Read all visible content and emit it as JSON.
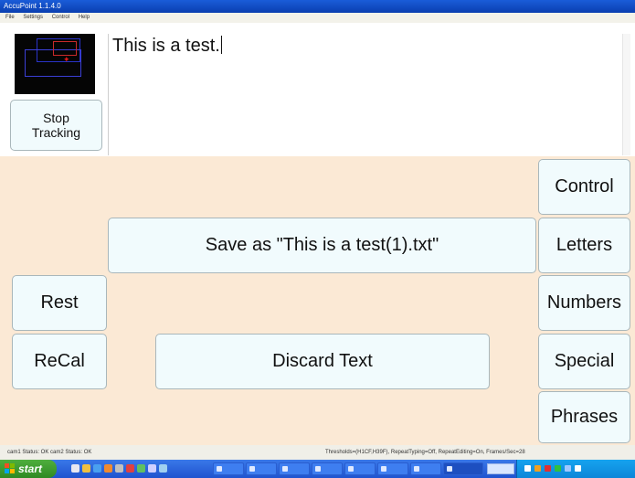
{
  "window": {
    "title": "AccuPoint 1.1.4.0"
  },
  "menu": {
    "items": [
      "File",
      "Settings",
      "Control",
      "Help"
    ]
  },
  "header": {
    "stop_tracking_label": "Stop\nTracking"
  },
  "editor": {
    "text": "This is a test."
  },
  "buttons": {
    "control": "Control",
    "letters": "Letters",
    "numbers": "Numbers",
    "special": "Special",
    "phrases": "Phrases",
    "save": "Save as \"This is a test(1).txt\"",
    "rest": "Rest",
    "recal": "ReCal",
    "discard": "Discard Text"
  },
  "status": {
    "left": "cam1 Status: OK cam2 Status: OK",
    "right": "Thresholds=(H1CF,H39F), RepeatTyping=Off, RepeatEditing=On, Frames/Sec=28"
  },
  "taskbar": {
    "start_label": "start"
  },
  "colors": {
    "panel_bg": "#fbe9d5",
    "button_bg": "#f1fbfd",
    "taskbar": "#2a63d8",
    "start": "#3a9a2d"
  }
}
